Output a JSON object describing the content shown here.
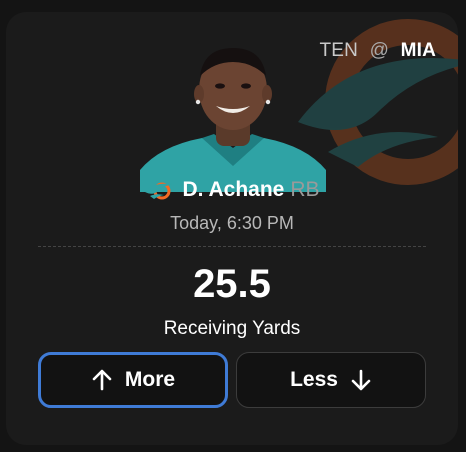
{
  "matchup": {
    "away": "TEN",
    "at": "@",
    "home": "MIA"
  },
  "player": {
    "name": "D. Achane",
    "position": "RB"
  },
  "game_time": "Today, 6:30 PM",
  "line": {
    "value": "25.5",
    "stat": "Receiving Yards"
  },
  "buttons": {
    "more": "More",
    "less": "Less"
  },
  "icons": {
    "team_logo": "dolphins-logo-icon",
    "more": "arrow-up-icon",
    "less": "arrow-down-icon"
  },
  "colors": {
    "card_bg": "#1b1b1b",
    "accent_selected": "#3f7bd6",
    "team_teal": "#2fa3a5",
    "team_orange": "#f26a24"
  }
}
